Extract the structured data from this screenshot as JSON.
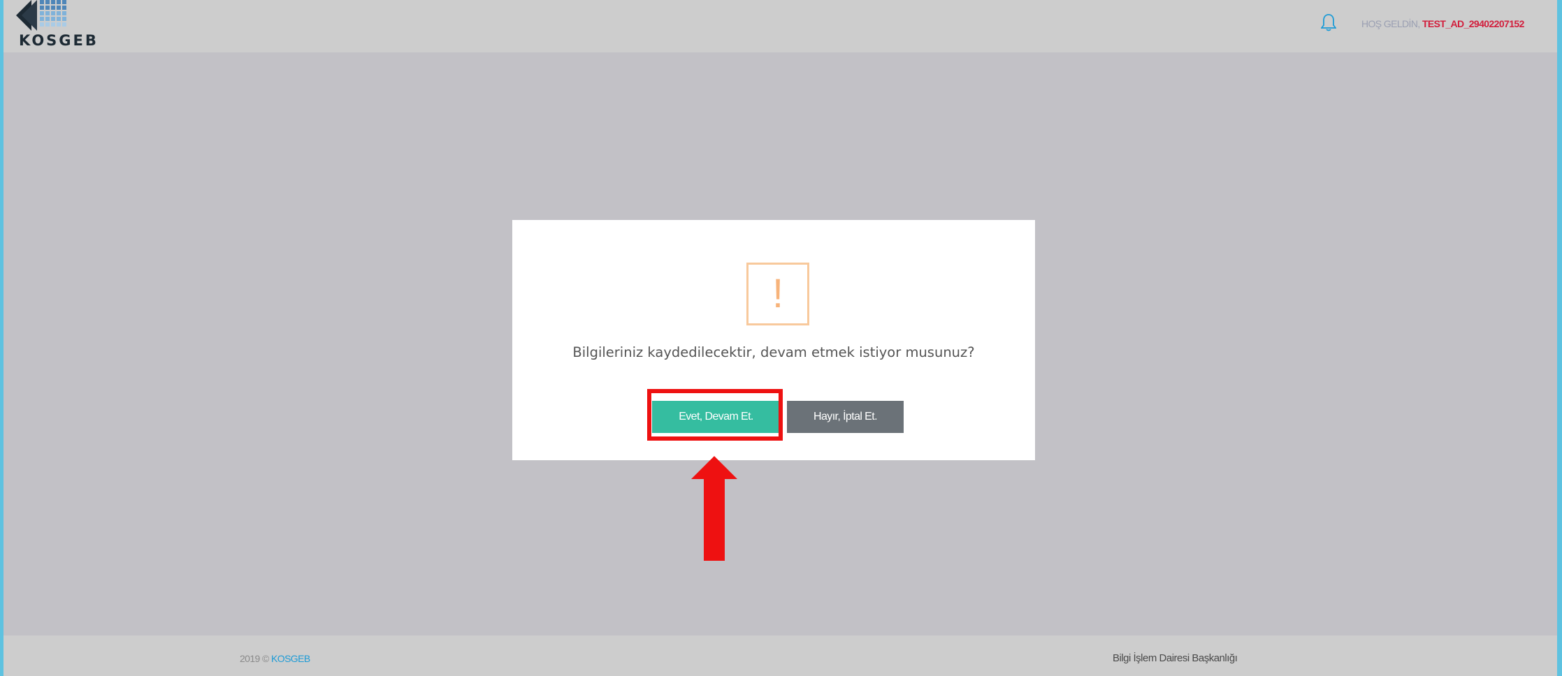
{
  "header": {
    "logo_text": "KOSGEB",
    "welcome_label": "HOŞ GELDİN,",
    "username": "TEST_AD_29402207152",
    "bell_icon": "bell-icon"
  },
  "dialog": {
    "icon": "warning-exclamation-icon",
    "icon_glyph": "!",
    "message": "Bilgileriniz kaydedilecektir, devam etmek istiyor musunuz?",
    "confirm_label": "Evet, Devam Et.",
    "cancel_label": "Hayır, İptal Et."
  },
  "footer": {
    "year_prefix": "2019 ©",
    "brand": "KOSGEB",
    "department": "Bilgi İşlem Dairesi Başkanlığı"
  },
  "colors": {
    "confirm_button": "#35bda0",
    "cancel_button": "#6b7278",
    "annotation": "#ee1111",
    "username": "#d21e3c",
    "warning": "#f8c99c"
  }
}
